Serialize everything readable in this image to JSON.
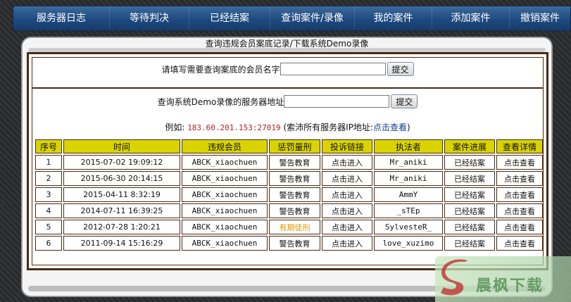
{
  "nav": {
    "items": [
      {
        "label": "服务器日志"
      },
      {
        "label": "等待判决"
      },
      {
        "label": "已经结案"
      },
      {
        "label": "查询案件/录像"
      },
      {
        "label": "我的案件"
      },
      {
        "label": "添加案件"
      },
      {
        "label": "撤销案件"
      }
    ]
  },
  "panel": {
    "title": "查询违规会员案底记录/下载系统Demo录像"
  },
  "search_member": {
    "label": "请填写需要查询案底的会员名字",
    "value": "",
    "placeholder": "",
    "button": "提交"
  },
  "search_demo": {
    "label": "查询系统Demo录像的服务器地址",
    "value": "",
    "placeholder": "",
    "button": "提交"
  },
  "example": {
    "prefix": "例如:",
    "value": "183.60.201.153:27019",
    "note_open": "(索沛所有服务器IP地址:",
    "link": "点击查看",
    "note_close": ")"
  },
  "table": {
    "headers": [
      "序号",
      "时间",
      "违规会员",
      "惩罚量刑",
      "投诉链接",
      "执法者",
      "案件进展",
      "查看详情"
    ],
    "rows": [
      {
        "no": "1",
        "time": "2015-07-02 19:09:12",
        "member": "ABCK_xiaochuen",
        "penalty": "警告教育",
        "link": "点击进入",
        "enforcer": "Mr_aniki",
        "status": "已经结案",
        "detail": "点击查看"
      },
      {
        "no": "2",
        "time": "2015-06-30 20:14:15",
        "member": "ABCK_xiaochuen",
        "penalty": "警告教育",
        "link": "点击进入",
        "enforcer": "Mr_aniki",
        "status": "已经结案",
        "detail": "点击查看"
      },
      {
        "no": "3",
        "time": "2015-04-11 8:32:19",
        "member": "ABCK_xiaochuen",
        "penalty": "警告教育",
        "link": "点击进入",
        "enforcer": "AmmY",
        "status": "已经结案",
        "detail": "点击查看"
      },
      {
        "no": "4",
        "time": "2014-07-11 16:39:25",
        "member": "ABCK_xiaochuen",
        "penalty": "警告教育",
        "link": "点击进入",
        "enforcer": "_sTEp",
        "status": "已经结案",
        "detail": "点击查看"
      },
      {
        "no": "5",
        "time": "2012-07-28 1:20:21",
        "member": "ABCK_xiaochuen",
        "penalty": "有期徒刑",
        "link": "点击进入",
        "enforcer": "SylvesteR_",
        "status": "已经结案",
        "detail": "点击查看"
      },
      {
        "no": "6",
        "time": "2011-09-14 15:16:29",
        "member": "ABCK_xiaochuen",
        "penalty": "警告教育",
        "link": "点击进入",
        "enforcer": "love_xuzimo",
        "status": "已经结案",
        "detail": "点击查看"
      }
    ]
  },
  "watermark": {
    "text": "晨枫下载",
    "icon": "watermark-logo-icon"
  },
  "colors": {
    "nav_bg": "#1e4a7f",
    "header_yellow": "#d9d400",
    "border_brown": "#4a2a12",
    "status_red": "#b0202a",
    "penalty_green": "#1f7a3a",
    "penalty_orange": "#d99a00",
    "link_blue": "#1a3d8a"
  }
}
